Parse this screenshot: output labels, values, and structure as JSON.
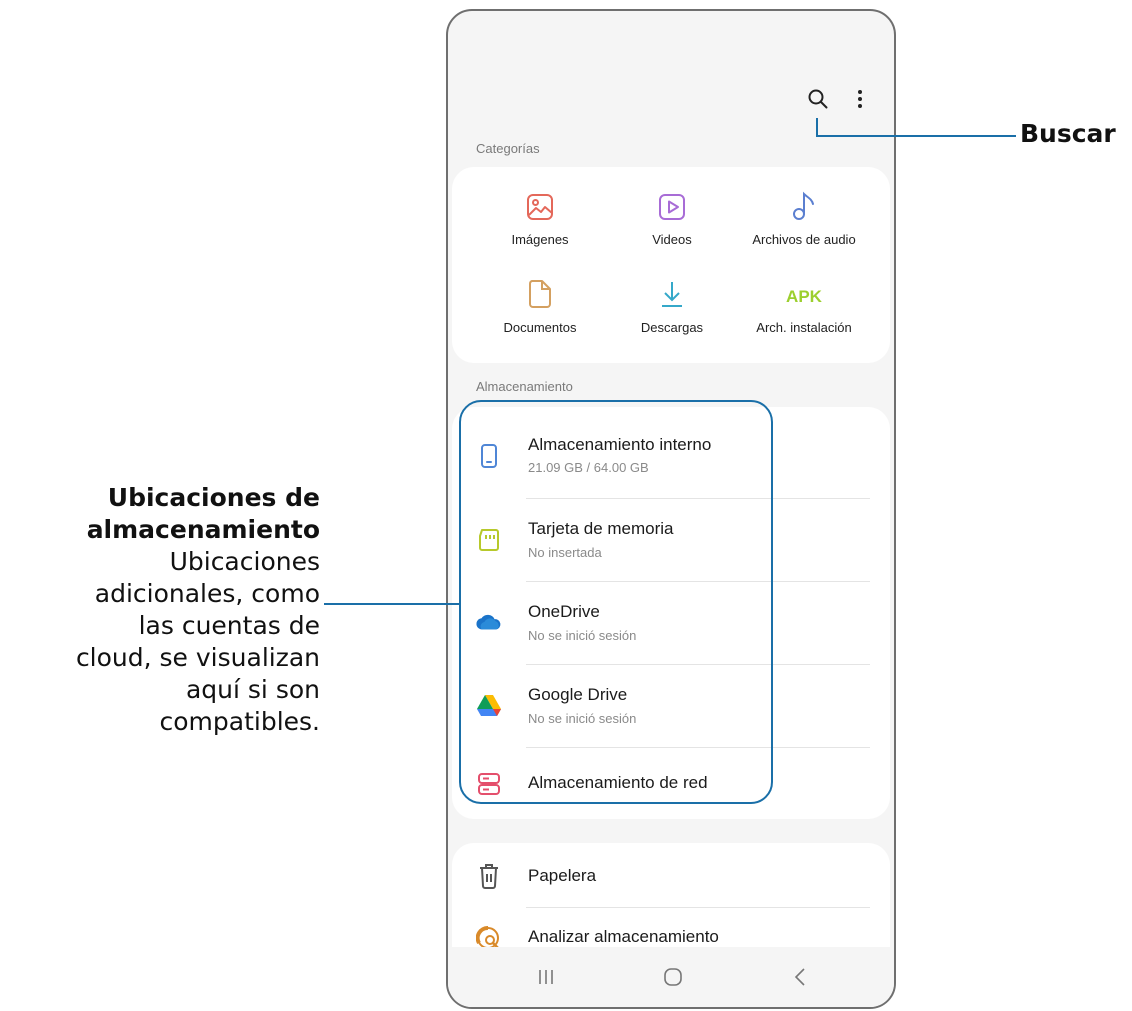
{
  "callouts": {
    "search": "Buscar",
    "storage_title_line1": "Ubicaciones de",
    "storage_title_line2": "almacenamiento",
    "storage_desc_lines": [
      "Ubicaciones",
      "adicionales, como",
      "las cuentas de",
      "cloud, se visualizan",
      "aquí si son",
      "compatibles."
    ]
  },
  "toolbar": {
    "search_icon": "search-icon",
    "more_icon": "more-vert-icon"
  },
  "categories": {
    "title": "Categorías",
    "items": [
      {
        "label": "Imágenes",
        "icon": "image-icon",
        "color": "#e4685a"
      },
      {
        "label": "Videos",
        "icon": "video-icon",
        "color": "#a86cd6"
      },
      {
        "label": "Archivos de audio",
        "icon": "music-note-icon",
        "color": "#5b7fd0"
      },
      {
        "label": "Documentos",
        "icon": "document-icon",
        "color": "#d4a060"
      },
      {
        "label": "Descargas",
        "icon": "download-icon",
        "color": "#35a8c9"
      },
      {
        "label": "Arch. instalación",
        "icon": "apk-icon",
        "color": "#9ccf2e",
        "text": "APK"
      }
    ]
  },
  "storage": {
    "title": "Almacenamiento",
    "items": [
      {
        "title": "Almacenamiento interno",
        "subtitle": "21.09 GB / 64.00 GB",
        "icon": "phone-icon",
        "color": "#4f86d6"
      },
      {
        "title": "Tarjeta de memoria",
        "subtitle": "No insertada",
        "icon": "sd-card-icon",
        "color": "#b7c92b"
      },
      {
        "title": "OneDrive",
        "subtitle": "No se inició sesión",
        "icon": "onedrive-icon",
        "color": "#1a73c9"
      },
      {
        "title": "Google Drive",
        "subtitle": "No se inició sesión",
        "icon": "google-drive-icon"
      },
      {
        "title": "Almacenamiento de red",
        "subtitle": "",
        "icon": "network-storage-icon",
        "color": "#e44f6c"
      }
    ]
  },
  "tools": {
    "items": [
      {
        "title": "Papelera",
        "icon": "trash-icon",
        "color": "#555555"
      },
      {
        "title": "Analizar almacenamiento",
        "icon": "analyze-storage-icon",
        "color": "#d98a2a"
      }
    ]
  },
  "navbar": {
    "recents_icon": "recents-icon",
    "home_icon": "home-icon",
    "back_icon": "back-icon"
  },
  "colors": {
    "callout_line": "#1a6fa8",
    "highlight_border": "#1a6fa8"
  }
}
